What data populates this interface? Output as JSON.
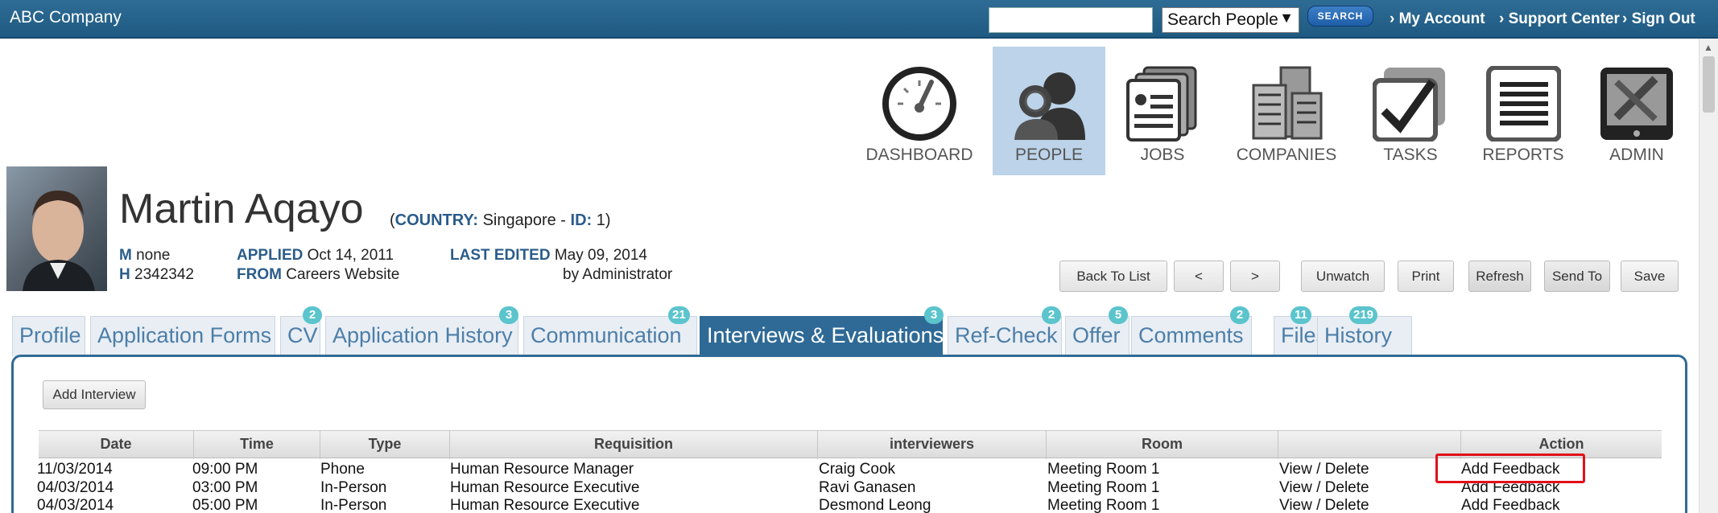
{
  "header": {
    "company": "ABC Company",
    "search_value": "",
    "search_select": "Search People",
    "search_button": "SEARCH",
    "links": [
      "› My Account",
      "› Support Center",
      "› Sign Out"
    ]
  },
  "nav": [
    {
      "label": "DASHBOARD",
      "icon": "dashboard-gauge-icon"
    },
    {
      "label": "PEOPLE",
      "icon": "people-icon",
      "active": true
    },
    {
      "label": "JOBS",
      "icon": "jobs-cards-icon"
    },
    {
      "label": "COMPANIES",
      "icon": "companies-buildings-icon"
    },
    {
      "label": "TASKS",
      "icon": "tasks-checkbox-icon"
    },
    {
      "label": "REPORTS",
      "icon": "reports-document-icon"
    },
    {
      "label": "ADMIN",
      "icon": "admin-tools-icon"
    }
  ],
  "profile": {
    "name": "Martin Aqayo",
    "country_label": "COUNTRY:",
    "country": "Singapore",
    "id_label": "ID:",
    "id": "1",
    "m_label": "M",
    "m_value": "none",
    "h_label": "H",
    "h_value": "2342342",
    "applied_label": "APPLIED",
    "applied": "Oct 14, 2011",
    "from_label": "FROM",
    "from": "Careers Website",
    "last_edited_label": "LAST EDITED",
    "last_edited": "May 09, 2014",
    "edited_by": "by Administrator"
  },
  "actions": [
    "Back To List",
    "<",
    ">",
    "Unwatch",
    "Print",
    "Refresh",
    "Send To",
    "Save"
  ],
  "tabs": [
    {
      "label": "Profile",
      "badge": ""
    },
    {
      "label": "Application Forms",
      "badge": ""
    },
    {
      "label": "CV",
      "badge": "2"
    },
    {
      "label": "Application History",
      "badge": "3"
    },
    {
      "label": "Communication",
      "badge": "21"
    },
    {
      "label": "Interviews & Evaluations",
      "badge": "3",
      "active": true
    },
    {
      "label": "Ref-Check",
      "badge": "2"
    },
    {
      "label": "Offer",
      "badge": "5"
    },
    {
      "label": "Comments",
      "badge": "2"
    },
    {
      "label": "Files",
      "badge": "11"
    },
    {
      "label": "History",
      "badge": "219"
    }
  ],
  "panel": {
    "add_interview": "Add Interview",
    "columns": [
      "Date",
      "Time",
      "Type",
      "Requisition",
      "interviewers",
      "Room",
      "",
      "Action"
    ],
    "rows": [
      [
        "11/03/2014",
        "09:00 PM",
        "Phone",
        "Human Resource Manager",
        "Craig Cook",
        "Meeting Room 1",
        "View / Delete",
        "Add Feedback"
      ],
      [
        "04/03/2014",
        "03:00 PM",
        "In-Person",
        "Human Resource Executive",
        "Ravi Ganasen",
        "Meeting Room 1",
        "View / Delete",
        "Add Feedback"
      ],
      [
        "04/03/2014",
        "05:00 PM",
        "In-Person",
        "Human Resource Executive",
        "Desmond Leong",
        "Meeting Room 1",
        "View / Delete",
        "Add Feedback"
      ]
    ]
  },
  "colors": {
    "header": "#1e5a82",
    "tab_active": "#2f6a96",
    "badge": "#5bc4cd",
    "highlight": "#e2101a"
  }
}
